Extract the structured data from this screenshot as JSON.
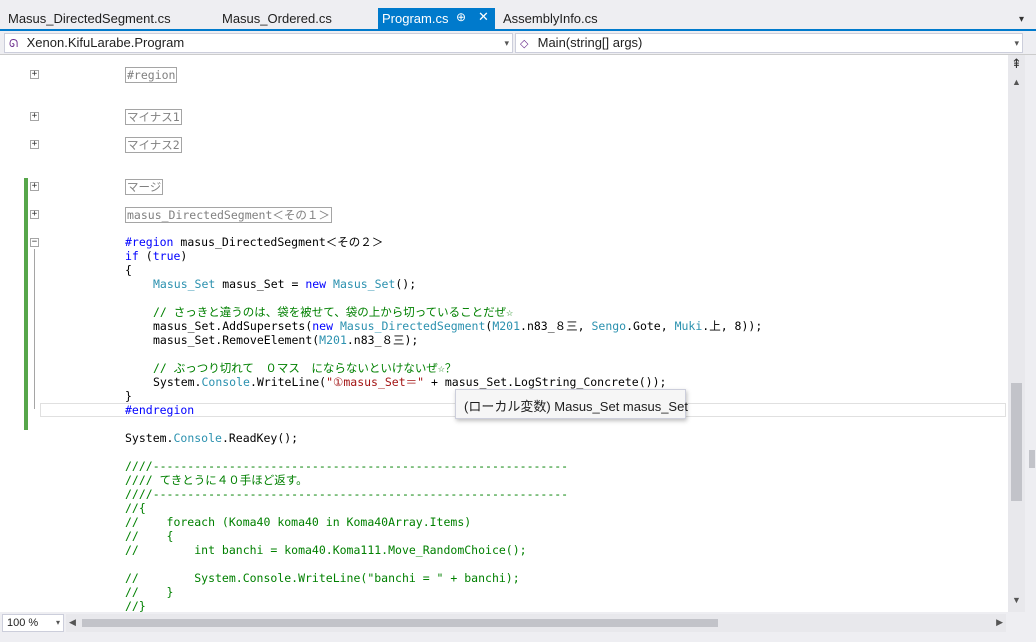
{
  "tabs": [
    {
      "label": "Masus_DirectedSegment.cs",
      "active": false
    },
    {
      "label": "Masus_Ordered.cs",
      "active": false
    },
    {
      "label": "Program.cs",
      "active": true
    },
    {
      "label": "AssemblyInfo.cs",
      "active": false
    }
  ],
  "tab_pin_glyph": "⊕",
  "tab_close_glyph": "✕",
  "tab_overflow_glyph": "▾",
  "nav": {
    "class_selector": "Xenon.KifuLarabe.Program",
    "member_selector": "Main(string[] args)",
    "member_icon": "method-icon"
  },
  "code": {
    "l_region1": "#region",
    "l_region2": "マイナス1",
    "l_region3": "マイナス2",
    "l_region4": "マージ",
    "l_region5": "masus_DirectedSegment＜その１＞",
    "l_region6_kw": "#region",
    "l_region6_name": " masus_DirectedSegment＜その２＞",
    "l_if_kw": "if",
    "l_if_rest1": " (",
    "l_if_true": "true",
    "l_if_rest2": ")",
    "l_brace_open": "{",
    "l_decl_t1": "Masus_Set",
    "l_decl_mid": " masus_Set = ",
    "l_decl_new": "new",
    "l_decl_sp": " ",
    "l_decl_t2": "Masus_Set",
    "l_decl_end": "();",
    "l_cmt1": "// さっきと違うのは、袋を被せて、袋の上から切っていることだぜ☆",
    "l_add_a": "masus_Set.AddSupersets(",
    "l_add_new": "new",
    "l_add_sp": " ",
    "l_add_t1": "Masus_DirectedSegment",
    "l_add_b": "(",
    "l_add_t2": "M201",
    "l_add_c": ".n83_８三, ",
    "l_add_t3": "Sengo",
    "l_add_d": ".Gote, ",
    "l_add_t4": "Muki",
    "l_add_e": ".上, 8));",
    "l_rem_a": "masus_Set.RemoveElement(",
    "l_rem_t": "M201",
    "l_rem_b": ".n83_８三);",
    "l_cmt2": "// ぶっつり切れて　０マス　にならないといけないぜ☆？",
    "l_wl_a": "System.",
    "l_wl_t": "Console",
    "l_wl_b": ".WriteLine(",
    "l_wl_str": "\"①masus_Set＝\"",
    "l_wl_c": " + masus_Set.LogString_Concrete());",
    "l_brace_close": "}",
    "l_endregion": "#endregion",
    "l_rk_a": "System.",
    "l_rk_t": "Console",
    "l_rk_b": ".ReadKey();",
    "l_c1": "////------------------------------------------------------------",
    "l_c2": "//// てきとうに４０手ほど返す。",
    "l_c3": "////------------------------------------------------------------",
    "l_c4": "//{",
    "l_c5": "//    foreach (Koma40 koma40 in Koma40Array.Items)",
    "l_c6": "//    {",
    "l_c7": "//        int banchi = koma40.Koma111.Move_RandomChoice();",
    "l_c8": "//        System.Console.WriteLine(\"banchi = \" + banchi);",
    "l_c9": "//    }",
    "l_c10": "//}"
  },
  "tooltip": "(ローカル変数) Masus_Set masus_Set",
  "expander_collapsed": "+",
  "expander_expanded": "−",
  "scroll": {
    "split_glyph": "⇞",
    "up": "▲",
    "down": "▼",
    "left": "◀",
    "right": "▶"
  },
  "zoom": "100 %",
  "dropdown_glyph": "▾"
}
